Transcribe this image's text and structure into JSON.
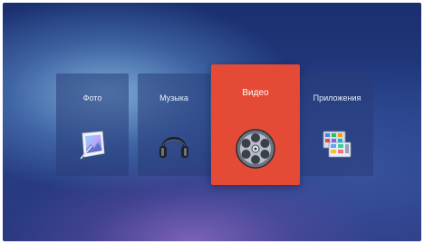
{
  "menu": {
    "items": [
      {
        "label": "Фото",
        "icon": "photo-icon"
      },
      {
        "label": "Музыка",
        "icon": "headphones-icon"
      },
      {
        "label": "Видео",
        "icon": "film-reel-icon",
        "selected": true
      },
      {
        "label": "Приложения",
        "icon": "apps-icon"
      }
    ]
  },
  "colors": {
    "selected_tile": "#e44a35",
    "tile": "#2d4480",
    "background": "#233c82"
  }
}
